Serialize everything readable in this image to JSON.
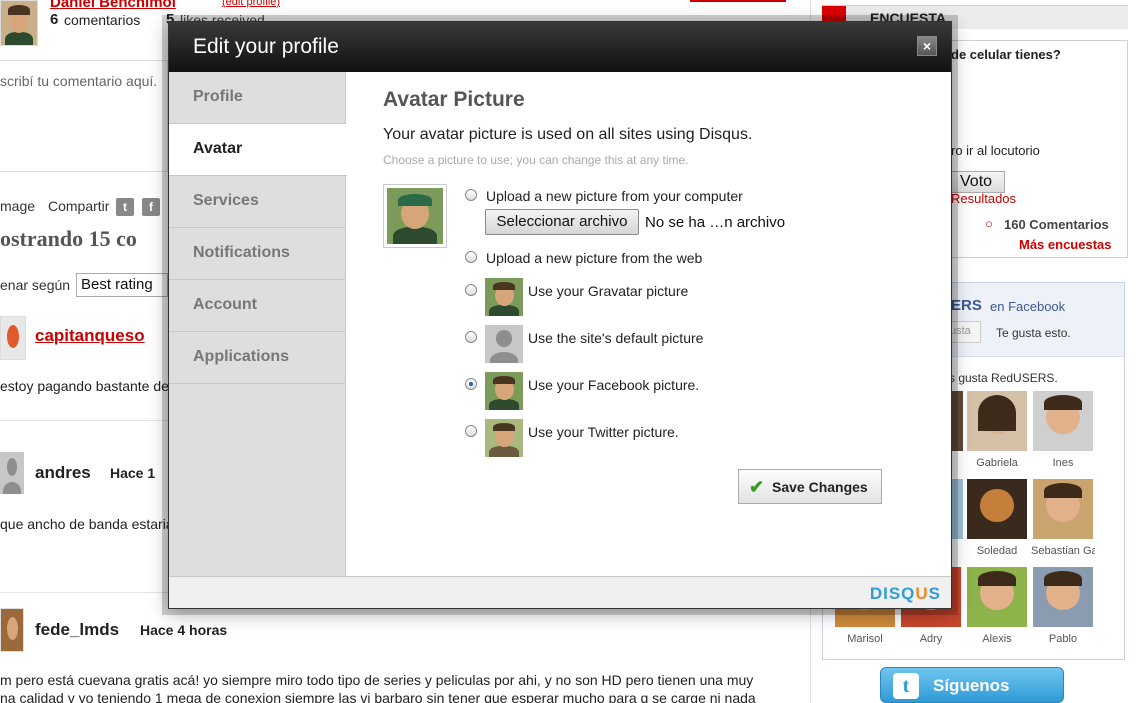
{
  "background": {
    "user_name": "Daniel Benchimol",
    "edit_profile": "(edit profile)",
    "comments_count": "6",
    "comments_label": "comentarios",
    "likes_count": "5",
    "likes_label": "likes received",
    "comment_placeholder": "scribí tu comentario aquí.",
    "image_link": "mage",
    "share_label": "Compartir",
    "showing": "ostrando 15 co",
    "sort_label": "enar según",
    "sort_value": "Best rating",
    "comments": [
      {
        "user": "capitanqueso",
        "time": "",
        "text": "estoy pagando bastante de"
      },
      {
        "user": "andres",
        "time": "Hace 1",
        "text": "que ancho de banda estaria"
      },
      {
        "user": "fede_lmds",
        "time": "Hace 4 horas",
        "text": "m pero está cuevana gratis acá! yo siempre miro todo tipo de series y peliculas por ahi, y no son HD pero tienen una muy"
      },
      {
        "user": "",
        "time": "",
        "text": "na calidad y yo teniendo 1 mega de conexion siempre las vi barbaro sin tener que esperar mucho para q se carge ni nada"
      }
    ]
  },
  "sidebar": {
    "poll_title": "ENCUESTA",
    "poll_question": "de celular tienes?",
    "poll_option": "ro ir al locutorio",
    "vote_button": "Voto",
    "results_link": "Resultados",
    "comments_count": "160 Comentarios",
    "more_polls": "Más encuestas",
    "fb_brand": "ERS",
    "fb_on": "en Facebook",
    "fb_like_btn": "usta",
    "fb_like_text": "Te gusta esto.",
    "fb_fans_text": "s gusta RedUSERS.",
    "fans": [
      "Gabriela",
      "Ines",
      "Soledad",
      "Sebastian Ga",
      "Marisol",
      "Adry",
      "Alexis",
      "Pablo"
    ],
    "twitter_label": "Síguenos"
  },
  "modal": {
    "title": "Edit your profile",
    "close": "×",
    "nav": [
      "Profile",
      "Avatar",
      "Services",
      "Notifications",
      "Account",
      "Applications"
    ],
    "active_nav": "Avatar",
    "section_title": "Avatar Picture",
    "description": "Your avatar picture is used on all sites using Disqus.",
    "hint": "Choose a picture to use; you can change this at any time.",
    "options": [
      {
        "label": "Upload a new picture from your computer",
        "checked": false
      },
      {
        "label": "Upload a new picture from the web",
        "checked": false
      },
      {
        "label": "Use your Gravatar picture",
        "checked": false
      },
      {
        "label": "Use the site's default picture",
        "checked": false
      },
      {
        "label": "Use your Facebook picture.",
        "checked": true
      },
      {
        "label": "Use your Twitter picture.",
        "checked": false
      }
    ],
    "file_button": "Seleccionar archivo",
    "file_name": "No se ha …n archivo",
    "save_button": "Save Changes",
    "brand_a": "DISQ",
    "brand_b": "U",
    "brand_c": "S"
  },
  "colors": {
    "header_dark": "#101010",
    "brand_blue": "#2e9fd5",
    "brand_orange": "#f08a1c",
    "link_red": "#cc0000"
  }
}
